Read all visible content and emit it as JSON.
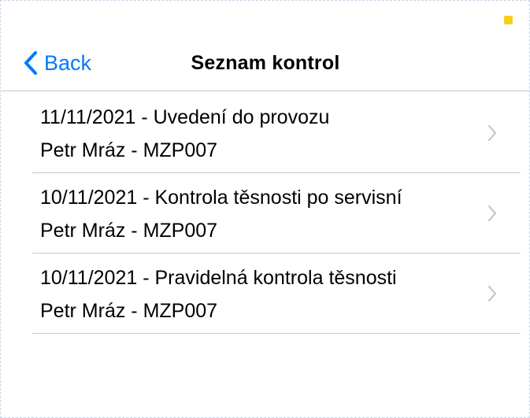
{
  "nav": {
    "back_label": "Back",
    "title": "Seznam kontrol"
  },
  "colors": {
    "accent": "#007aff",
    "separator": "#c8c8cc",
    "chevron": "#c7c7cc",
    "status_dot": "#f5cf1a"
  },
  "icons": {
    "back": "chevron-left-icon",
    "row": "chevron-right-icon"
  },
  "records": [
    {
      "title": "11/11/2021 - Uvedení do provozu",
      "subtitle": "Petr Mráz - MZP007"
    },
    {
      "title": "10/11/2021 - Kontrola těsnosti po servisní",
      "subtitle": "Petr Mráz - MZP007"
    },
    {
      "title": "10/11/2021 - Pravidelná kontrola těsnosti",
      "subtitle": "Petr Mráz - MZP007"
    }
  ]
}
